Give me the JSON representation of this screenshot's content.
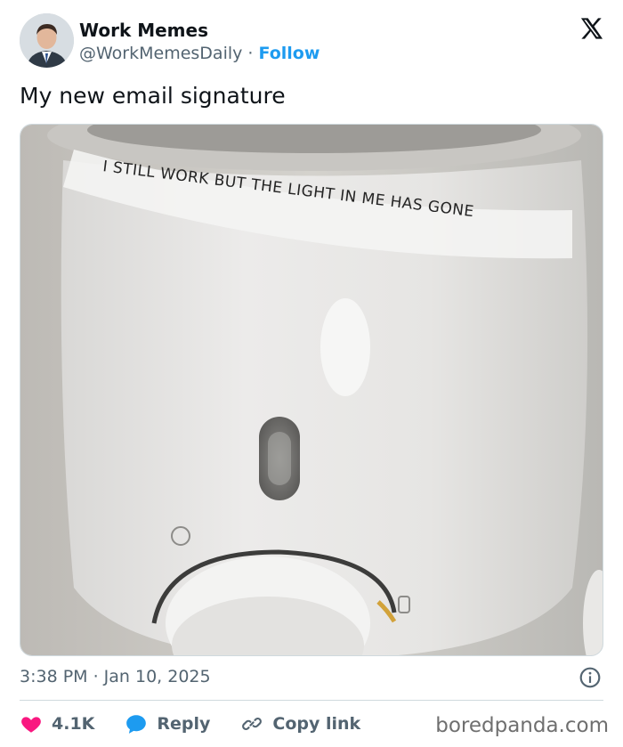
{
  "author": {
    "name": "Work Memes",
    "handle": "@WorkMemesDaily",
    "separator": "·",
    "follow_label": "Follow"
  },
  "platform_icon": "x-logo-icon",
  "tweet_text": "My new email signature",
  "media": {
    "label_text": "I STILL WORK BUT THE LIGHT IN ME HAS GONE"
  },
  "timestamp": "3:38 PM · Jan 10, 2025",
  "actions": {
    "likes_count": "4.1K",
    "reply_label": "Reply",
    "copy_link_label": "Copy link"
  },
  "watermark": "boredpanda.com",
  "colors": {
    "accent": "#1d9bf0",
    "like": "#f91880",
    "secondary_text": "#536471"
  }
}
